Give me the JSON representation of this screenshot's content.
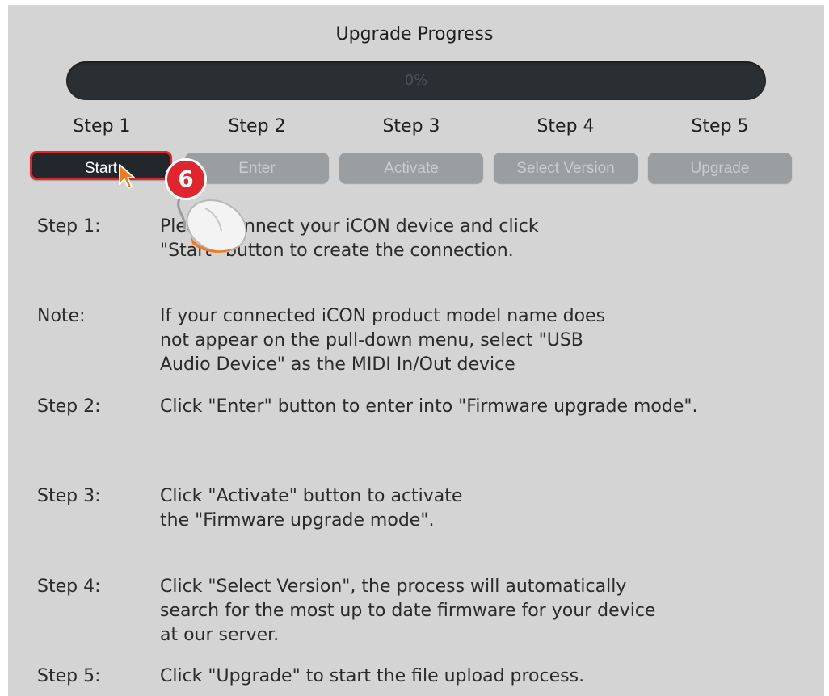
{
  "window": {
    "title": "Upgrade Progress"
  },
  "progress": {
    "value": 0,
    "label": "0%"
  },
  "steps": [
    {
      "label": "Step 1",
      "button": "Start",
      "active": true
    },
    {
      "label": "Step 2",
      "button": "Enter",
      "active": false
    },
    {
      "label": "Step 3",
      "button": "Activate",
      "active": false
    },
    {
      "label": "Step 4",
      "button": "Select Version",
      "active": false
    },
    {
      "label": "Step 5",
      "button": "Upgrade",
      "active": false
    }
  ],
  "annotation": {
    "badge": "6"
  },
  "instructions": [
    {
      "label": "Step 1:",
      "lines": [
        "Please connect your iCON device and click",
        "\"Start\" button to create the connection."
      ]
    },
    {
      "label": "Note:",
      "lines": [
        "If your connected iCON product model name does",
        "not appear on the pull-down menu, select \"USB",
        "Audio Device\" as the MIDI In/Out device"
      ]
    },
    {
      "label": "Step 2:",
      "lines": [
        "Click \"Enter\" button to enter into \"Firmware upgrade mode\"."
      ]
    },
    {
      "label": "Step 3:",
      "lines": [
        "Click \"Activate\" button to activate",
        "the \"Firmware upgrade mode\"."
      ]
    },
    {
      "label": "Step 4:",
      "lines": [
        "Click \"Select Version\", the process will automatically",
        "search for the most up to date firmware for your device",
        "at our server."
      ]
    },
    {
      "label": "Step 5:",
      "lines": [
        "Click \"Upgrade\" to start the file upload process."
      ]
    }
  ],
  "colors": {
    "active_border": "#e0262c",
    "badge": "#e0262c",
    "panel": "#d4d4d4",
    "progress_track": "#2a2f33",
    "cursor": "#f07a1e"
  },
  "icons": [
    "mouse-icon",
    "cursor-arrow-icon"
  ]
}
